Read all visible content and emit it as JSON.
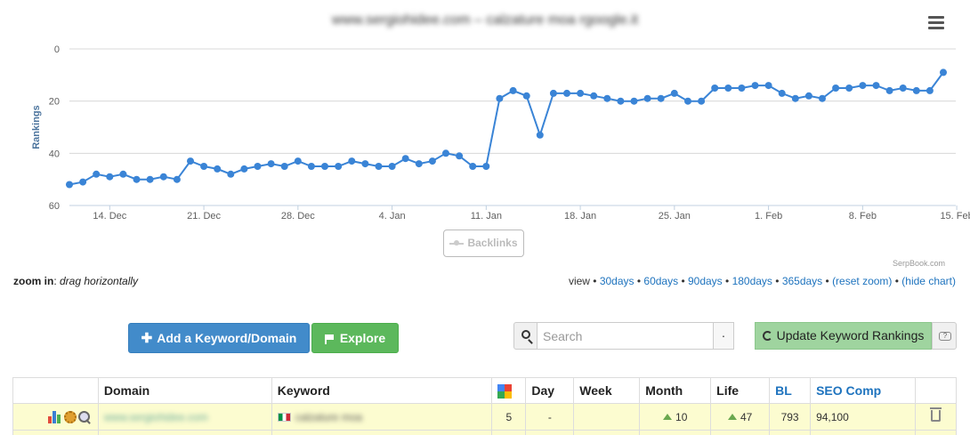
{
  "chart": {
    "title": "www.sergiohidee.com – calzature moa rgoogle.it",
    "credit": "SerpBook.com",
    "legend_label": "Backlinks"
  },
  "chart_data": {
    "type": "line",
    "ylabel": "Rankings",
    "ylim": [
      0,
      60
    ],
    "y_reversed": true,
    "y_ticks": [
      "0",
      "20",
      "40",
      "60"
    ],
    "x_ticks": [
      "14. Dec",
      "21. Dec",
      "28. Dec",
      "4. Jan",
      "11. Jan",
      "18. Jan",
      "25. Jan",
      "1. Feb",
      "8. Feb",
      "15. Feb"
    ],
    "x_start": "2013-12-11",
    "series": [
      {
        "values": [
          52,
          51,
          48,
          49,
          48,
          50,
          50,
          49,
          50,
          43,
          45,
          46,
          48,
          46,
          45,
          44,
          45,
          43,
          45,
          45,
          45,
          43,
          44,
          45,
          45,
          42,
          44,
          43,
          40,
          41,
          45,
          45,
          19,
          16,
          18,
          33,
          17,
          17,
          17,
          18,
          19,
          20,
          20,
          19,
          19,
          17,
          20,
          20,
          15,
          15,
          15,
          14,
          14,
          17,
          19,
          18,
          19,
          15,
          15,
          14,
          14,
          16,
          15,
          16,
          16,
          9
        ],
        "color": "#3a84d6"
      }
    ],
    "grid": true,
    "legend": "bottom-center"
  },
  "controls": {
    "zoom_label": "zoom in",
    "zoom_hint": "drag horizontally",
    "view_label": "view",
    "views": [
      "30days",
      "60days",
      "90days",
      "180days",
      "365days"
    ],
    "reset_zoom": "(reset zoom)",
    "hide_chart": "(hide chart)"
  },
  "toolbar": {
    "add_label": "Add a Keyword/Domain",
    "explore_label": "Explore",
    "search_placeholder": "Search",
    "dot": "·",
    "update_label": "Update Keyword Rankings"
  },
  "table": {
    "headers": {
      "domain": "Domain",
      "keyword": "Keyword",
      "day": "Day",
      "week": "Week",
      "month": "Month",
      "life": "Life",
      "bl": "BL",
      "seo_comp": "SEO Comp"
    },
    "rows": [
      {
        "domain": "www.sergiohidee.com",
        "keyword": "calzature moa",
        "google_rank": "5",
        "day": "-",
        "week": "",
        "month": "10",
        "life": "47",
        "bl": "793",
        "seo_comp": "94,100"
      }
    ]
  }
}
